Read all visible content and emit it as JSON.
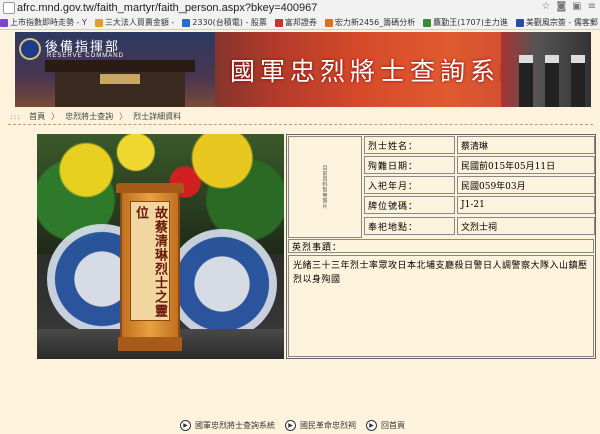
{
  "browser": {
    "url": "afrc.mnd.gov.tw/faith_martyr/faith_person.aspx?bkey=400967",
    "bookmarks": [
      {
        "label": "上市指數即時走勢 - Y",
        "color": "#7a4ac8"
      },
      {
        "label": "三大法人買賣金額 -",
        "color": "#e0a020"
      },
      {
        "label": "2330(台積電) - 股票",
        "color": "#2a6ac8"
      },
      {
        "label": "富邦證券",
        "color": "#d03030"
      },
      {
        "label": "宏力新2456_籌碼分析",
        "color": "#e07020"
      },
      {
        "label": "鷹勤王(1707)主力進",
        "color": "#3a8a3a"
      },
      {
        "label": "美觀風宗簽 - 儒客郵",
        "color": "#2a4aa8"
      }
    ]
  },
  "banner": {
    "command_title": "後備指揮部",
    "command_subtitle": "RESERVE COMMAND",
    "system_title": "國軍忠烈將士查詢系統"
  },
  "breadcrumb": {
    "dots": ":::",
    "items": [
      "首頁",
      "忠烈將士查詢",
      "烈士詳細資料"
    ]
  },
  "tablet": {
    "text": "故蔡清琳烈士之靈位"
  },
  "info": {
    "vertical_note": "目前資料暫無照片",
    "rows": [
      {
        "label": "烈士姓名：",
        "value": "蔡清琳"
      },
      {
        "label": "殉難日期：",
        "value": "民國前015年05月11日"
      },
      {
        "label": "入祀年月：",
        "value": "民國059年03月"
      },
      {
        "label": "牌位號碼：",
        "value": "J1-21"
      },
      {
        "label": "奉祀地點：",
        "value": "文烈士祠"
      }
    ],
    "merit_label": "英烈事蹟：",
    "merit_text": "光緒三十三年烈士率眾攻日本北埔支廳殺日警日人調警察大隊入山鎮壓烈以身殉國"
  },
  "footer": {
    "links": [
      "國軍忠烈將士查詢系統",
      "國民革命忠烈祠",
      "回首頁"
    ]
  }
}
